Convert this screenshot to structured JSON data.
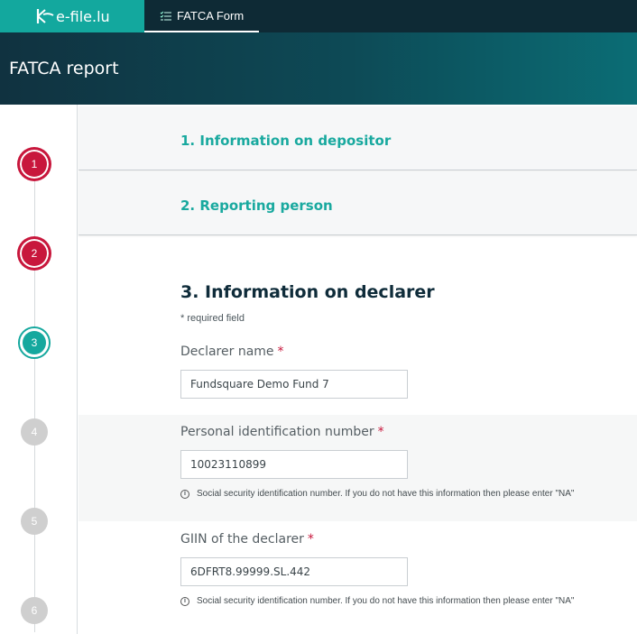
{
  "app": {
    "logo_text": "e-file.lu"
  },
  "topbar": {
    "tab_label": "FATCA Form"
  },
  "header": {
    "title": "FATCA report"
  },
  "stepper": {
    "steps": [
      {
        "number": "1",
        "state": "done"
      },
      {
        "number": "2",
        "state": "done"
      },
      {
        "number": "3",
        "state": "active"
      },
      {
        "number": "4",
        "state": "todo"
      },
      {
        "number": "5",
        "state": "todo"
      },
      {
        "number": "6",
        "state": "todo"
      }
    ]
  },
  "sections": {
    "s1_title": "1. Information on depositor",
    "s2_title": "2. Reporting person",
    "s3_title": "3. Information on declarer",
    "required_note": "* required field"
  },
  "fields": {
    "declarer_name": {
      "label": "Declarer name",
      "required_mark": "*",
      "value": "Fundsquare Demo Fund 7"
    },
    "pin": {
      "label": "Personal identification number",
      "required_mark": "*",
      "value": "10023110899",
      "hint": "Social security identification number. If you do not have this information then please enter \"NA\""
    },
    "giin": {
      "label": "GIIN of the declarer",
      "required_mark": "*",
      "value": "6DFRT8.99999.SL.442",
      "hint": "Social security identification number. If you do not have this information then please enter \"NA\""
    }
  },
  "colors": {
    "accent": "#15a89e",
    "done": "#c8173c",
    "header_dark": "#0e2a35"
  }
}
